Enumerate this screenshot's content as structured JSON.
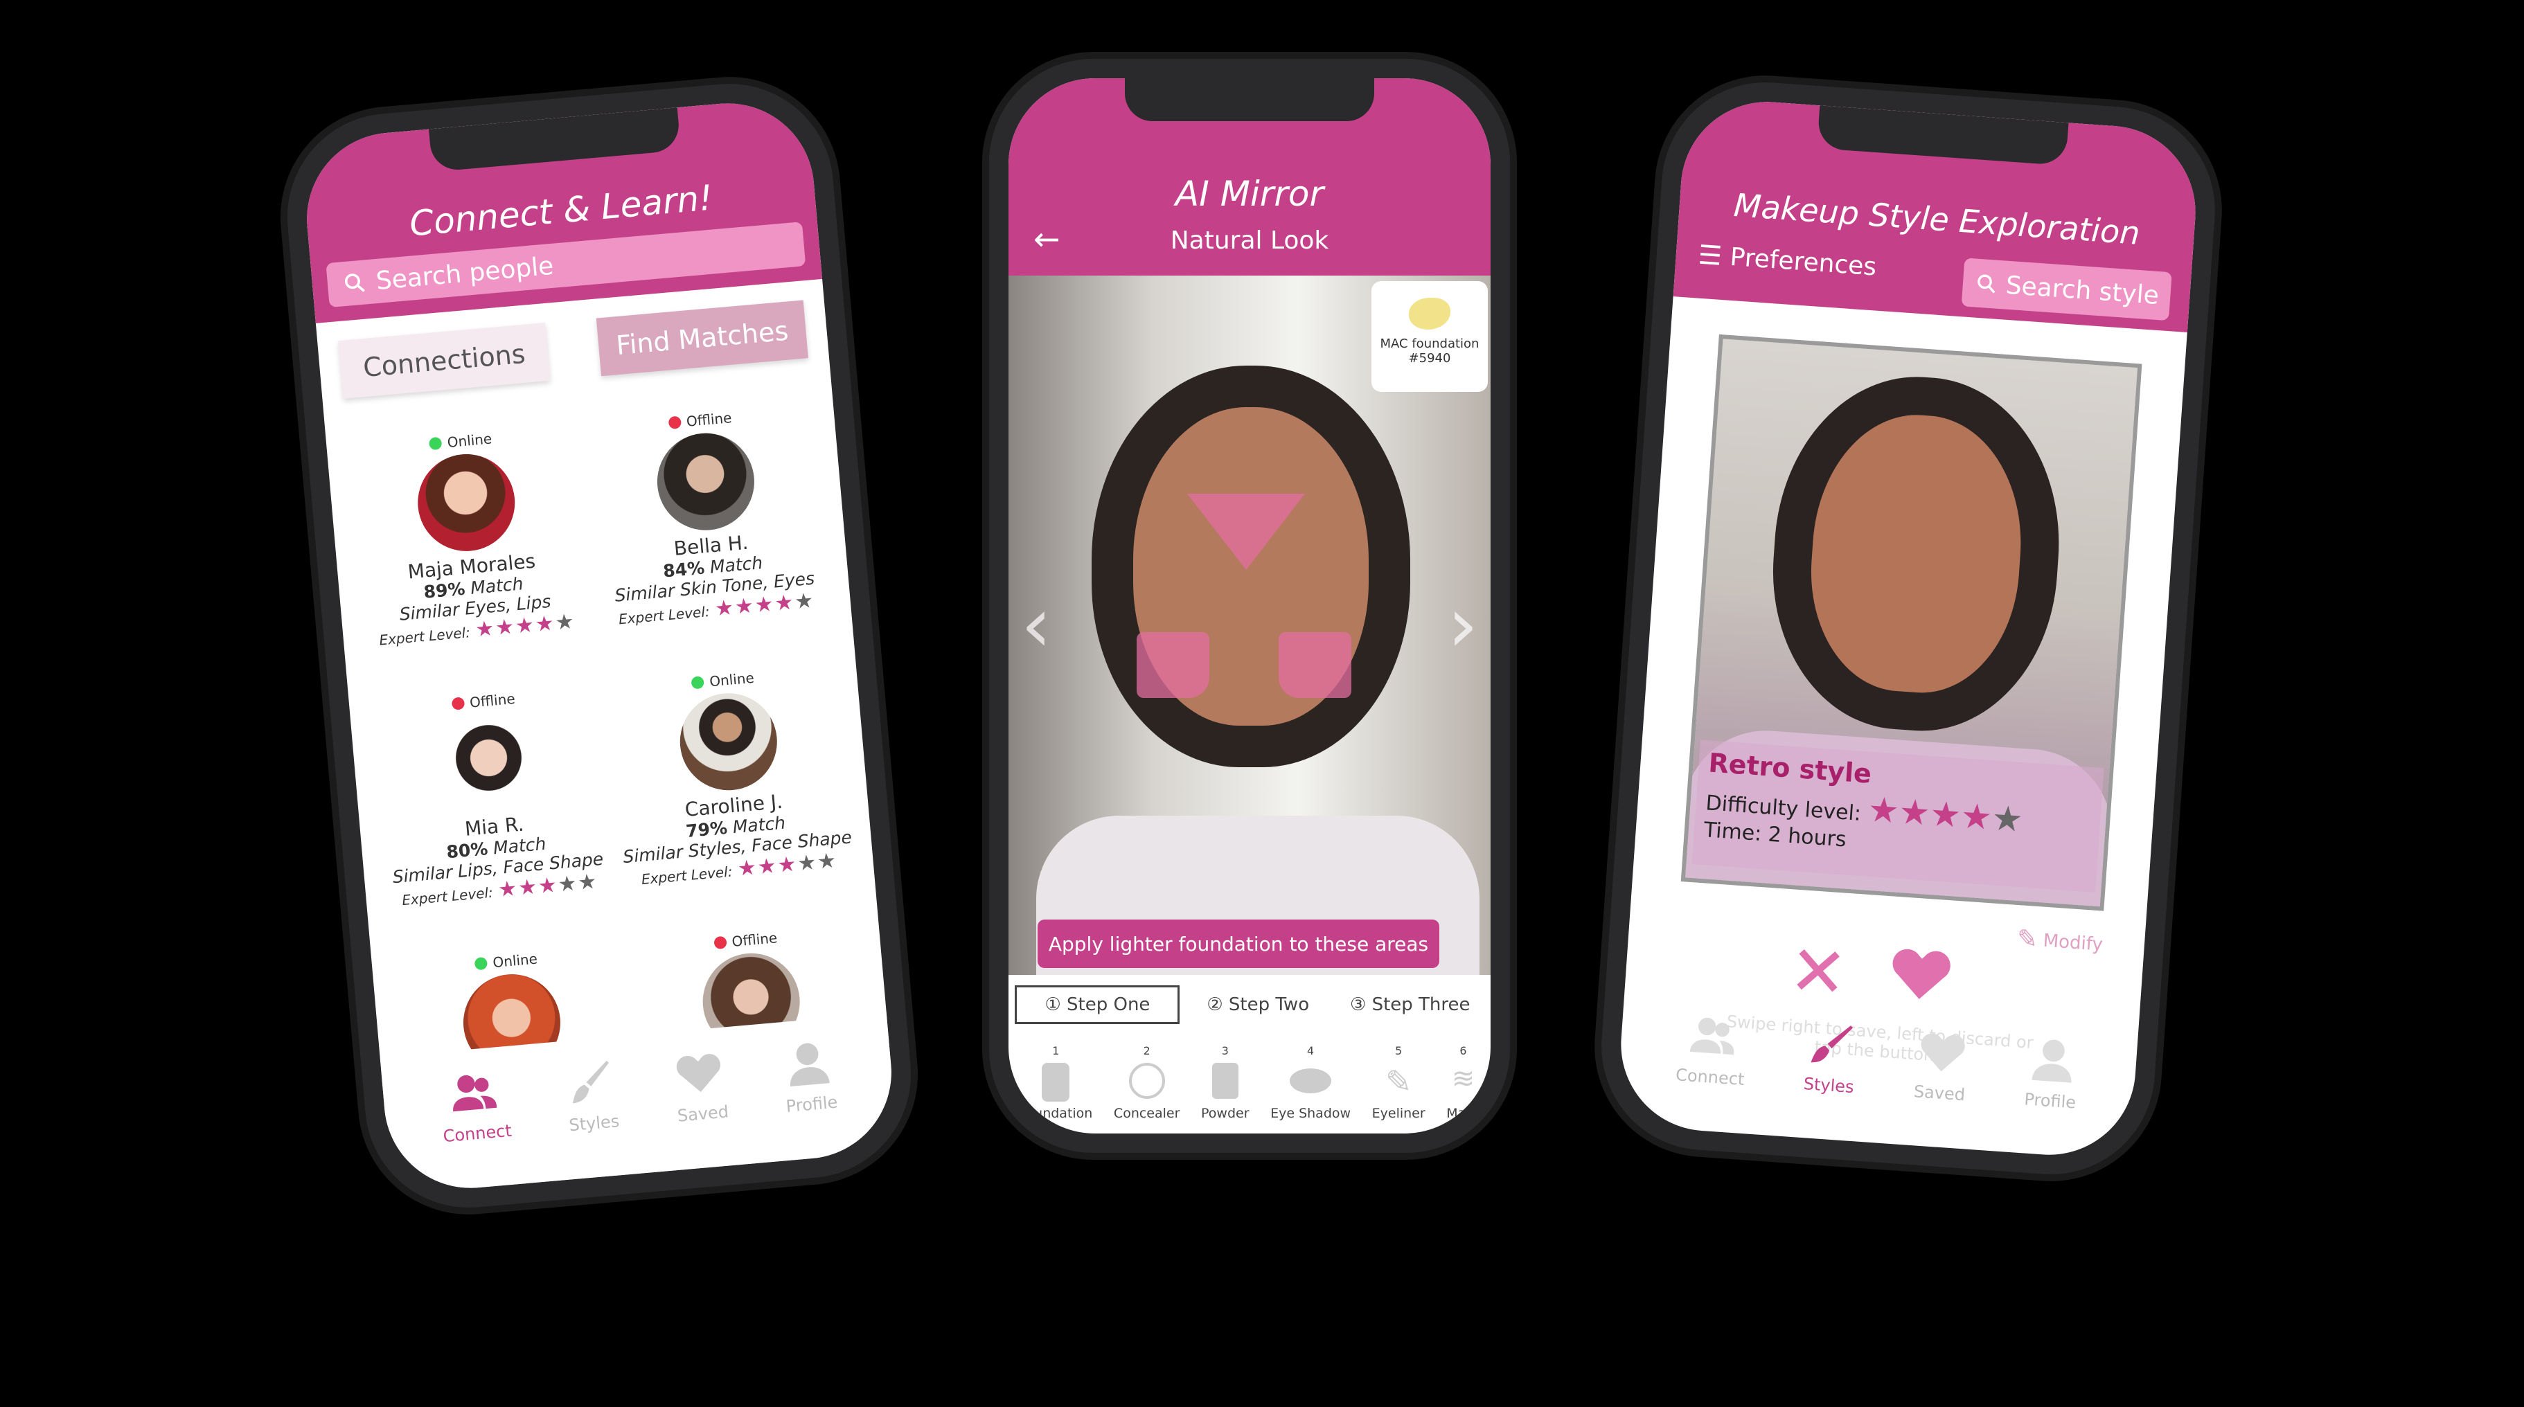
{
  "connect": {
    "title": "Connect & Learn!",
    "search_placeholder": "Search people",
    "tabs": [
      "Connections",
      "Find Matches"
    ],
    "people": [
      {
        "status": "Online",
        "name": "Maja Morales",
        "match_pct": "89%",
        "match": " Match",
        "similar": "Similar Eyes, Lips",
        "level_label": "Expert Level:",
        "stars": 4
      },
      {
        "status": "Offline",
        "name": "Bella H.",
        "match_pct": "84%",
        "match": " Match",
        "similar": "Similar Skin Tone, Eyes",
        "level_label": "Expert Level:",
        "stars": 4
      },
      {
        "status": "Offline",
        "name": "Mia R.",
        "match_pct": "80%",
        "match": " Match",
        "similar": "Similar Lips, Face Shape",
        "level_label": "Expert Level:",
        "stars": 3
      },
      {
        "status": "Online",
        "name": "Caroline J.",
        "match_pct": "79%",
        "match": " Match",
        "similar": "Similar Styles, Face Shape",
        "level_label": "Expert Level:",
        "stars": 3
      },
      {
        "status": "Online",
        "name": "",
        "match_pct": "",
        "match": "",
        "similar": "",
        "level_label": "",
        "stars": 0
      },
      {
        "status": "Offline",
        "name": "",
        "match_pct": "",
        "match": "",
        "similar": "",
        "level_label": "",
        "stars": 0
      }
    ],
    "nav": [
      "Connect",
      "Styles",
      "Saved",
      "Profile"
    ]
  },
  "mirror": {
    "title": "AI Mirror",
    "subtitle": "Natural Look",
    "product_name": "MAC foundation",
    "product_code": "#5940",
    "tip": "Apply lighter foundation to these areas",
    "steps": [
      "① Step One",
      "② Step Two",
      "③ Step Three"
    ],
    "tools": [
      {
        "num": "1",
        "label": "Foundation"
      },
      {
        "num": "2",
        "label": "Concealer"
      },
      {
        "num": "3",
        "label": "Powder"
      },
      {
        "num": "4",
        "label": "Eye Shadow"
      },
      {
        "num": "5",
        "label": "Eyeliner"
      },
      {
        "num": "6",
        "label": "Masc"
      }
    ]
  },
  "explore": {
    "title": "Makeup Style Exploration",
    "preferences": "Preferences",
    "search_placeholder": "Search style",
    "style_name": "Retro style",
    "difficulty_label": "Difficulty level:",
    "difficulty_stars": 4,
    "time": "Time: 2 hours",
    "modify": "Modify",
    "hint": "Swipe right to save, left to discard or tap the buttons",
    "nav": [
      "Connect",
      "Styles",
      "Saved",
      "Profile"
    ]
  },
  "colors": {
    "brand": "#c4418a",
    "online": "#3bd45a",
    "offline": "#e8324a"
  }
}
